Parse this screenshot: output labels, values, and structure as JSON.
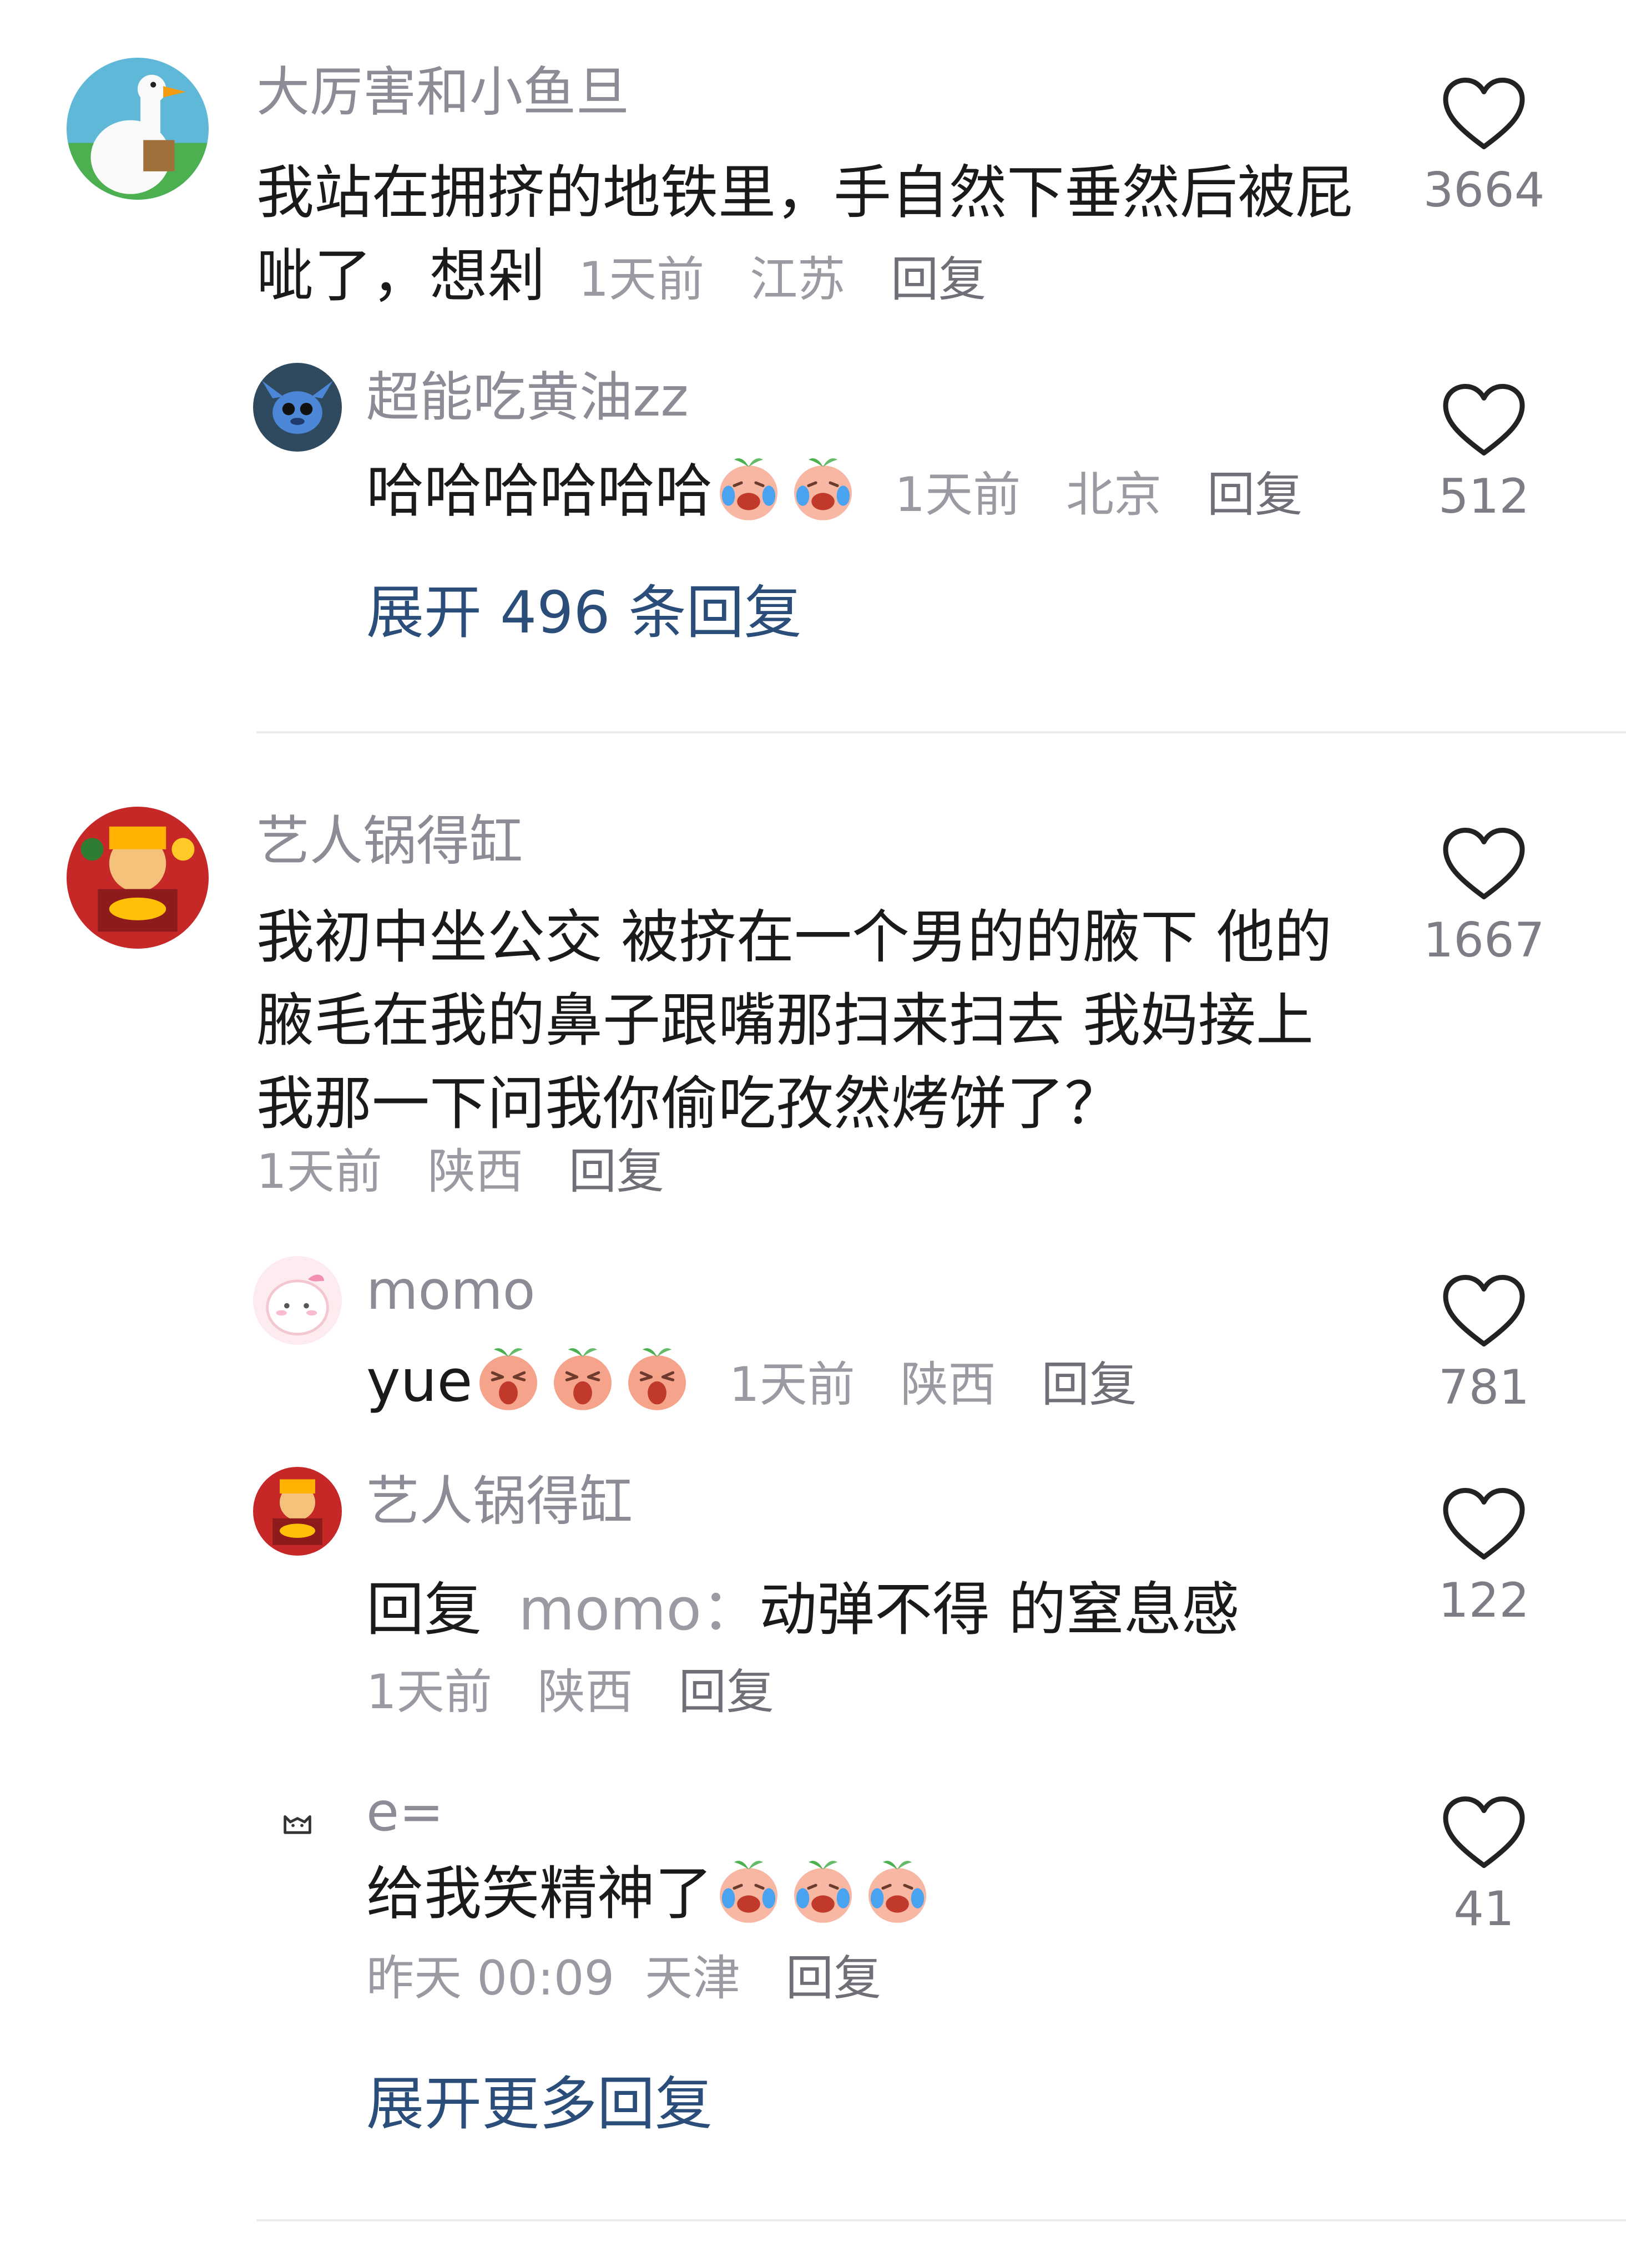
{
  "comments": [
    {
      "nickname": "大厉害和小鱼旦",
      "text": "我站在拥挤的地铁里，手自然下垂然后被屁呲了，想剁",
      "time": "1天前",
      "location": "江苏",
      "reply_label": "回复",
      "likes": "3664"
    },
    {
      "nickname": "超能吃黄油zz",
      "text": "哈哈哈哈哈哈",
      "time": "1天前",
      "location": "北京",
      "reply_label": "回复",
      "likes": "512"
    },
    {
      "nickname": "艺人锅得缸",
      "text": "我初中坐公交 被挤在一个男的的腋下 他的腋毛在我的鼻子跟嘴那扫来扫去 我妈接上我那一下问我你偷吃孜然烤饼了？",
      "time": "1天前",
      "location": "陕西",
      "reply_label": "回复",
      "likes": "1667"
    },
    {
      "nickname": "momo",
      "text": "yue",
      "time": "1天前",
      "location": "陕西",
      "reply_label": "回复",
      "likes": "781"
    },
    {
      "nickname": "艺人锅得缸",
      "reply_prefix": "回复",
      "mention": "momo：",
      "text": "动弹不得 的窒息感",
      "time": "1天前",
      "location": "陕西",
      "reply_label": "回复",
      "likes": "122"
    },
    {
      "nickname": "e=",
      "text": "给我笑精神了",
      "time": "昨天 00:09",
      "location": "天津",
      "reply_label": "回复",
      "likes": "41"
    }
  ],
  "expand_replies_1": "展开 496 条回复",
  "expand_replies_2": "展开更多回复",
  "icons": {
    "like": "heart-outline-icon",
    "emoji_cry": "crying-laugh-peach-emoji",
    "emoji_scream": "screaming-peach-emoji"
  },
  "colors": {
    "link": "#2a4d7a",
    "nickname": "#8c8c96",
    "text": "#1a1a1a",
    "meta": "#9a9aa2"
  }
}
